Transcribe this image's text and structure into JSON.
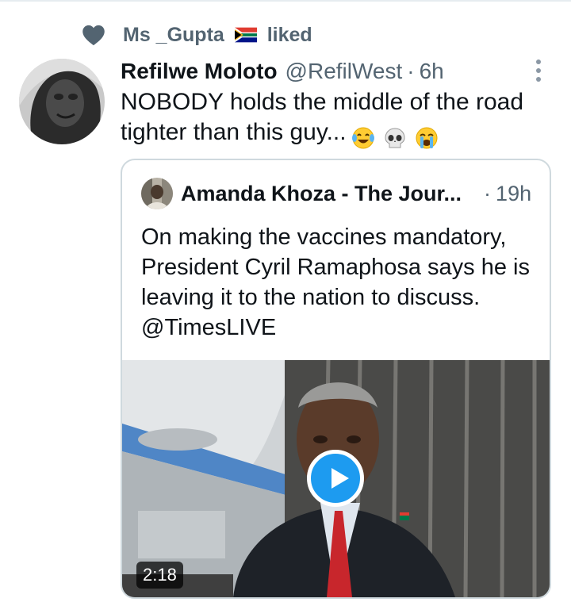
{
  "social_context": {
    "icon": "heart-icon",
    "user": "Ms _Gupta",
    "flag": "south-africa-flag-icon",
    "action": "liked"
  },
  "tweet": {
    "author_name": "Refilwe Moloto",
    "author_handle": "@RefilWest",
    "separator": "·",
    "time": "6h",
    "text": "NOBODY holds the middle of the road tighter than this guy...",
    "emojis": [
      "face-with-tears-of-joy-emoji",
      "skull-emoji",
      "crying-face-emoji"
    ]
  },
  "quoted_tweet": {
    "author_name": "Amanda Khoza - The Jour...",
    "separator": "·",
    "time": "19h",
    "text": "On making the vaccines mandatory, President Cyril Ramaphosa says he is leaving it to the nation to discuss. @TimesLIVE",
    "media": {
      "type": "video",
      "duration": "2:18"
    }
  },
  "colors": {
    "text_primary": "#0f1419",
    "text_secondary": "#536471",
    "accent": "#1d9bf0",
    "border": "#cfd9de"
  }
}
